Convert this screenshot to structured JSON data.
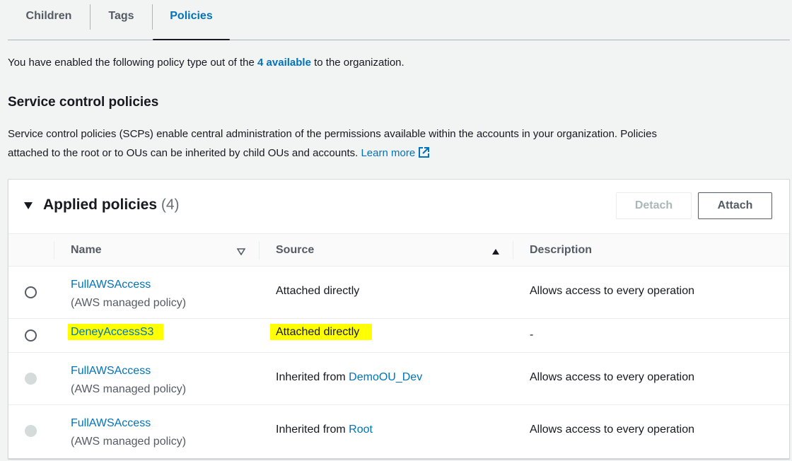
{
  "tabs": [
    {
      "label": "Children"
    },
    {
      "label": "Tags"
    },
    {
      "label": "Policies"
    }
  ],
  "intro": {
    "prefix": "You have enabled the following policy type out of the ",
    "link": "4 available",
    "suffix": " to the organization."
  },
  "section": {
    "title": "Service control policies",
    "desc_line1": "Service control policies (SCPs) enable central administration of the permissions available within the accounts in your organization. Policies",
    "desc_line2": "attached to the root or to OUs can be inherited by child OUs and accounts.",
    "learn_more": "Learn more"
  },
  "panel": {
    "title": "Applied policies",
    "count": "(4)",
    "detach_label": "Detach",
    "attach_label": "Attach"
  },
  "table": {
    "headers": {
      "name": "Name",
      "source": "Source",
      "description": "Description"
    },
    "rows": [
      {
        "name": "FullAWSAccess",
        "sub": "(AWS managed policy)",
        "source_prefix": "Attached directly",
        "source_link": "",
        "description": "Allows access to every operation"
      },
      {
        "name": "DeneyAccessS3",
        "sub": "",
        "source_prefix": "Attached directly",
        "source_link": "",
        "description": "-"
      },
      {
        "name": "FullAWSAccess",
        "sub": "(AWS managed policy)",
        "source_prefix": "Inherited from ",
        "source_link": "DemoOU_Dev",
        "description": "Allows access to every operation"
      },
      {
        "name": "FullAWSAccess",
        "sub": "(AWS managed policy)",
        "source_prefix": "Inherited from ",
        "source_link": "Root",
        "description": "Allows access to every operation"
      }
    ]
  },
  "colors": {
    "link": "#0073bb",
    "highlight": "#ffff00",
    "background": "#f2f3f3"
  },
  "icons": [
    "caret-down-icon",
    "external-link-icon",
    "sort-descending-icon",
    "sort-ascending-icon"
  ]
}
